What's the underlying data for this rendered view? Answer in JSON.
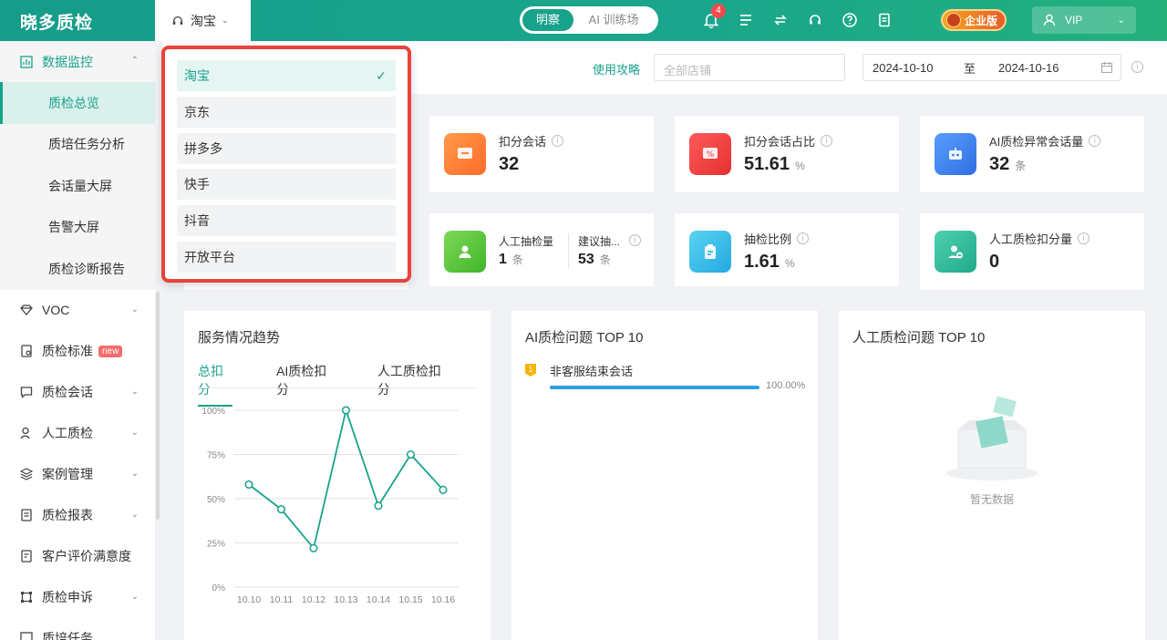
{
  "app": {
    "brand": "晓多质检"
  },
  "topbar": {
    "platform": "淘宝",
    "modes": [
      "明察",
      "AI 训练场"
    ],
    "notification_count": "4",
    "enterprise_label": "企业版",
    "vip_label": "VIP"
  },
  "sidebar": {
    "groups": [
      {
        "label": "数据监控",
        "icon": "chart-icon"
      },
      {
        "label": "VOC",
        "icon": "diamond-icon"
      },
      {
        "label": "质检标准",
        "icon": "doc-icon",
        "badge": "new"
      },
      {
        "label": "质检会话",
        "icon": "chat-icon"
      },
      {
        "label": "人工质检",
        "icon": "user-icon"
      },
      {
        "label": "案例管理",
        "icon": "layers-icon"
      },
      {
        "label": "质检报表",
        "icon": "report-icon"
      },
      {
        "label": "客户评价满意度",
        "icon": "rating-icon"
      },
      {
        "label": "质检申诉",
        "icon": "appeal-icon"
      },
      {
        "label": "质培任务",
        "icon": "task-icon"
      }
    ],
    "sub_items": [
      "质检总览",
      "质培任务分析",
      "会话量大屏",
      "告警大屏",
      "质检诊断报告"
    ]
  },
  "filters": {
    "guide": "使用攻略",
    "shop_placeholder": "全部店铺",
    "date_start": "2024-10-10",
    "date_sep": "至",
    "date_end": "2024-10-16"
  },
  "kpis": {
    "deduct_sessions": {
      "label": "扣分会话",
      "value": "32"
    },
    "deduct_ratio": {
      "label": "扣分会话占比",
      "value": "51.61",
      "unit": "%"
    },
    "ai_abnormal": {
      "label": "AI质检异常会话量",
      "value": "32",
      "unit": "条"
    },
    "manual_check": {
      "label": "人工抽检量",
      "value": "1",
      "unit": "条"
    },
    "suggest_check": {
      "label": "建议抽...",
      "value": "53",
      "unit": "条"
    },
    "check_ratio": {
      "label": "抽检比例",
      "value": "1.61",
      "unit": "%"
    },
    "manual_deduct": {
      "label": "人工质检扣分量",
      "value": "0"
    }
  },
  "trend": {
    "title": "服务情况趋势",
    "tabs": [
      "总扣分",
      "AI质检扣分",
      "人工质检扣分"
    ]
  },
  "chart_data": {
    "type": "line",
    "x": [
      "10.10",
      "10.11",
      "10.12",
      "10.13",
      "10.14",
      "10.15",
      "10.16"
    ],
    "series": [
      {
        "values": [
          58,
          44,
          22,
          100,
          46,
          75,
          55
        ]
      }
    ],
    "ylim": [
      0,
      100
    ],
    "yticks": [
      "0%",
      "25%",
      "50%",
      "75%",
      "100%"
    ],
    "grid": true,
    "color": "#18a28b"
  },
  "ai_top": {
    "title": "AI质检问题 TOP 10",
    "items": [
      {
        "rank": "1",
        "name": "非客服结束会话",
        "pct": "100.00%",
        "ratio": 1.0
      }
    ]
  },
  "manual_top": {
    "title": "人工质检问题 TOP 10",
    "empty": "暂无数据"
  },
  "dropdown": {
    "options": [
      "淘宝",
      "京东",
      "拼多多",
      "快手",
      "抖音",
      "开放平台"
    ],
    "selected": "淘宝"
  }
}
